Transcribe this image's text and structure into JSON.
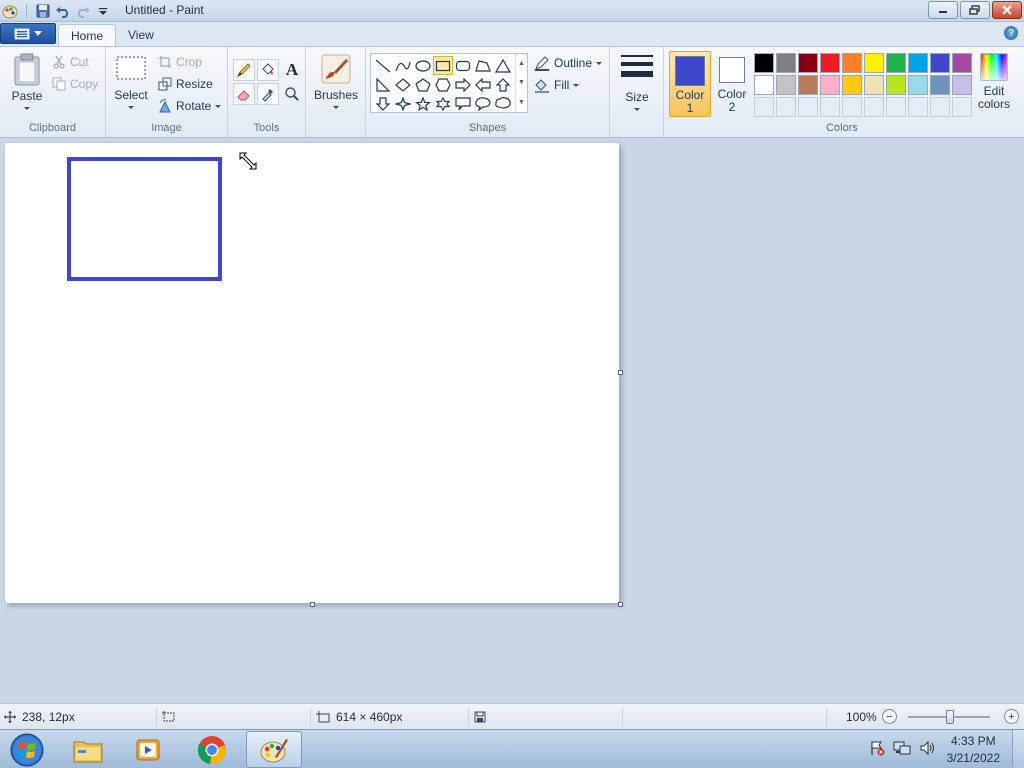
{
  "window": {
    "title": "Untitled - Paint"
  },
  "tabs": [
    {
      "label": "Home",
      "active": true
    },
    {
      "label": "View",
      "active": false
    }
  ],
  "ribbon": {
    "clipboard": {
      "group_label": "Clipboard",
      "paste_label": "Paste",
      "cut_label": "Cut",
      "copy_label": "Copy"
    },
    "image": {
      "group_label": "Image",
      "select_label": "Select",
      "crop_label": "Crop",
      "resize_label": "Resize",
      "rotate_label": "Rotate"
    },
    "tools": {
      "group_label": "Tools",
      "text_glyph": "A"
    },
    "brushes": {
      "label": "Brushes"
    },
    "shapes": {
      "group_label": "Shapes",
      "outline_label": "Outline",
      "fill_label": "Fill",
      "selected_shape": "rectangle"
    },
    "size": {
      "label": "Size"
    },
    "colors": {
      "group_label": "Colors",
      "color1_label_line1": "Color",
      "color1_label_line2": "1",
      "color1_value": "#3f48cc",
      "color2_label_line1": "Color",
      "color2_label_line2": "2",
      "color2_value": "#ffffff",
      "edit_colors_line1": "Edit",
      "edit_colors_line2": "colors",
      "palette_row1": [
        "#000000",
        "#7f7f7f",
        "#880015",
        "#ed1c24",
        "#ff7f27",
        "#fff200",
        "#22b14c",
        "#00a2e8",
        "#3f48cc",
        "#a349a4"
      ],
      "palette_row2": [
        "#ffffff",
        "#c3c3c3",
        "#b97a57",
        "#ffaec9",
        "#ffc90e",
        "#efe4b0",
        "#b5e61d",
        "#99d9ea",
        "#7092be",
        "#c8bfe7"
      ],
      "palette_row3": [
        "#e6ecf4",
        "#e6ecf4",
        "#e6ecf4",
        "#e6ecf4",
        "#e6ecf4",
        "#e6ecf4",
        "#e6ecf4",
        "#e6ecf4",
        "#e6ecf4",
        "#e6ecf4"
      ]
    }
  },
  "canvas": {
    "shape": "rectangle",
    "shape_color": "#3f48cc"
  },
  "status": {
    "cursor_pos": "238, 12px",
    "image_size": "614 × 460px",
    "zoom": "100%",
    "zoom_minus": "−",
    "zoom_plus": "+"
  },
  "taskbar": {
    "apps": [
      "explorer",
      "media-player",
      "chrome",
      "paint"
    ],
    "active_app": "paint",
    "time": "4:33 PM",
    "date": "3/21/2022"
  }
}
